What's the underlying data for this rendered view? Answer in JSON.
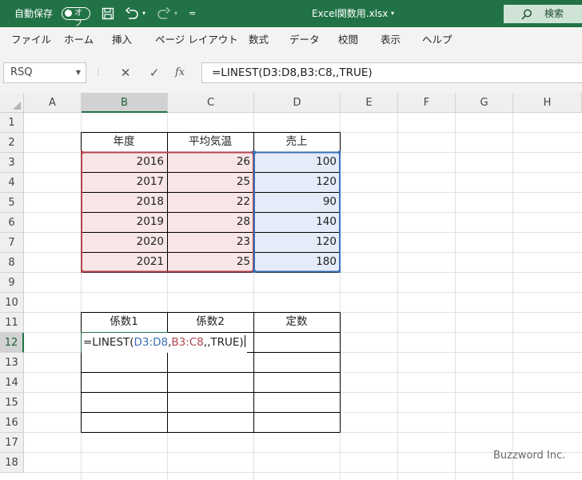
{
  "titlebar": {
    "autosave_label": "自動保存",
    "autosave_state": "オフ",
    "filename": "Excel関数用.xlsx",
    "search_label": "検索"
  },
  "ribbon": {
    "tabs": [
      "ファイル",
      "ホーム",
      "挿入",
      "ページ レイアウト",
      "数式",
      "データ",
      "校閲",
      "表示",
      "ヘルプ"
    ]
  },
  "formula_bar": {
    "name_box": "RSQ",
    "fx_label": "fx",
    "formula": "=LINEST(D3:D8,B3:C8,,TRUE)"
  },
  "sheet": {
    "columns": [
      "A",
      "B",
      "C",
      "D",
      "E",
      "F",
      "G",
      "H"
    ],
    "rows": [
      "1",
      "2",
      "3",
      "4",
      "5",
      "6",
      "7",
      "8",
      "9",
      "10",
      "11",
      "12",
      "13",
      "14",
      "15",
      "16",
      "17",
      "18"
    ],
    "table1": {
      "headers": [
        "年度",
        "平均気温",
        "売上"
      ],
      "rows": [
        [
          "2016",
          "26",
          "100"
        ],
        [
          "2017",
          "25",
          "120"
        ],
        [
          "2018",
          "22",
          "90"
        ],
        [
          "2019",
          "28",
          "140"
        ],
        [
          "2020",
          "23",
          "120"
        ],
        [
          "2021",
          "25",
          "180"
        ]
      ]
    },
    "table2": {
      "headers": [
        "係数1",
        "係数2",
        "定数"
      ]
    },
    "edit_cell": {
      "prefix": "=LINEST(",
      "ref1": "D3:D8",
      "comma1": ",",
      "ref2": "B3:C8",
      "suffix": ",,TRUE)"
    }
  },
  "watermark": "Buzzword Inc.",
  "colors": {
    "excel_green": "#217346",
    "ref_red_border": "#b0454d",
    "ref_red_fill": "#f8e5e6",
    "ref_blue_border": "#3b6fb6",
    "ref_blue_fill": "#e3ecf8"
  }
}
